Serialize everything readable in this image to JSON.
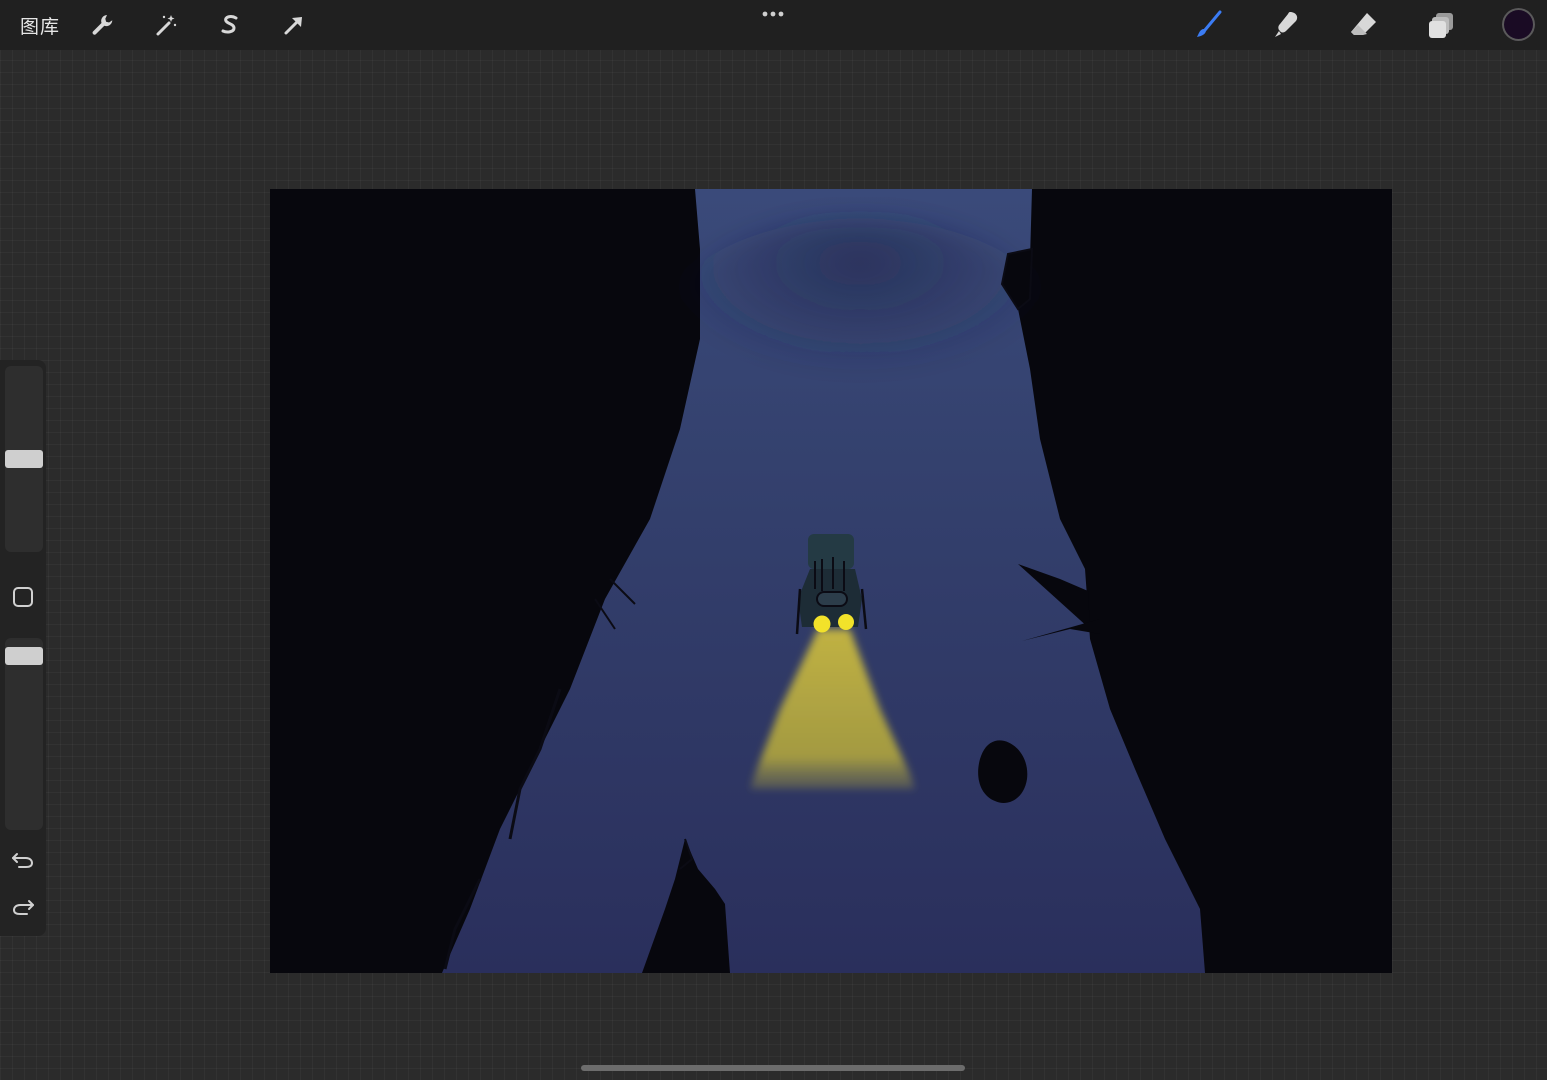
{
  "toolbar": {
    "gallery_label": "图库",
    "left_tools": [
      {
        "name": "actions",
        "icon": "wrench-icon"
      },
      {
        "name": "adjustments",
        "icon": "magic-wand-icon"
      },
      {
        "name": "selection",
        "icon": "selection-s-icon"
      },
      {
        "name": "transform",
        "icon": "arrow-cursor-icon"
      }
    ],
    "more_icon": "ellipsis-icon",
    "right_tools": [
      {
        "name": "brush",
        "icon": "brush-icon",
        "active": true
      },
      {
        "name": "smudge",
        "icon": "smudge-icon",
        "active": false
      },
      {
        "name": "eraser",
        "icon": "eraser-icon",
        "active": false
      },
      {
        "name": "layers",
        "icon": "layers-icon",
        "active": false
      }
    ],
    "current_color": "#1a0b24",
    "accent_color": "#3b7cf4"
  },
  "sidebar": {
    "brush_size_level": 0.5,
    "brush_opacity_level": 0.98,
    "modify_icon": "square-icon",
    "undo_icon": "undo-icon",
    "redo_icon": "redo-icon"
  },
  "canvas": {
    "colors": {
      "background": "#07070d",
      "road_top": "#3a4a7a",
      "road_bottom": "#2a2f5c",
      "headlight_beam": "#b8ab3e",
      "headlights": "#f2e22a"
    }
  }
}
